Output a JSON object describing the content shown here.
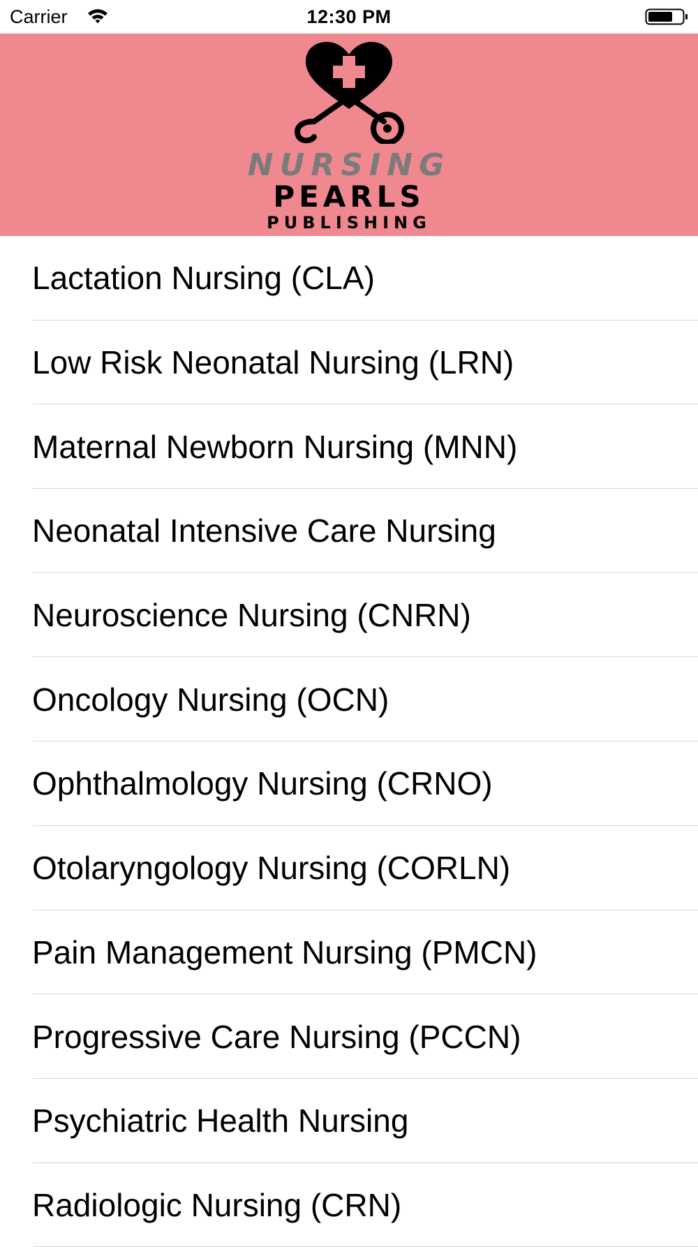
{
  "status_bar": {
    "carrier": "Carrier",
    "time": "12:30 PM",
    "icons": [
      "wifi-icon",
      "battery-icon"
    ]
  },
  "header": {
    "background_color": "#f08890",
    "logo": {
      "icon": "heart-stethoscope-logo",
      "line1": "NURSING",
      "line2": "PEARLS",
      "line3": "PUBLISHING",
      "line1_color": "#7b7b7b",
      "line2_color": "#000000"
    }
  },
  "list": {
    "items": [
      {
        "label": "Lactation Nursing (CLA)"
      },
      {
        "label": "Low Risk Neonatal Nursing (LRN)"
      },
      {
        "label": "Maternal Newborn Nursing (MNN)"
      },
      {
        "label": "Neonatal Intensive Care Nursing"
      },
      {
        "label": "Neuroscience Nursing (CNRN)"
      },
      {
        "label": "Oncology Nursing (OCN)"
      },
      {
        "label": "Ophthalmology Nursing (CRNO)"
      },
      {
        "label": "Otolaryngology Nursing (CORLN)"
      },
      {
        "label": "Pain Management Nursing (PMCN)"
      },
      {
        "label": "Progressive Care Nursing (PCCN)"
      },
      {
        "label": "Psychiatric Health Nursing"
      },
      {
        "label": "Radiologic Nursing (CRN)"
      }
    ],
    "separator_color": "#d6d6da"
  }
}
